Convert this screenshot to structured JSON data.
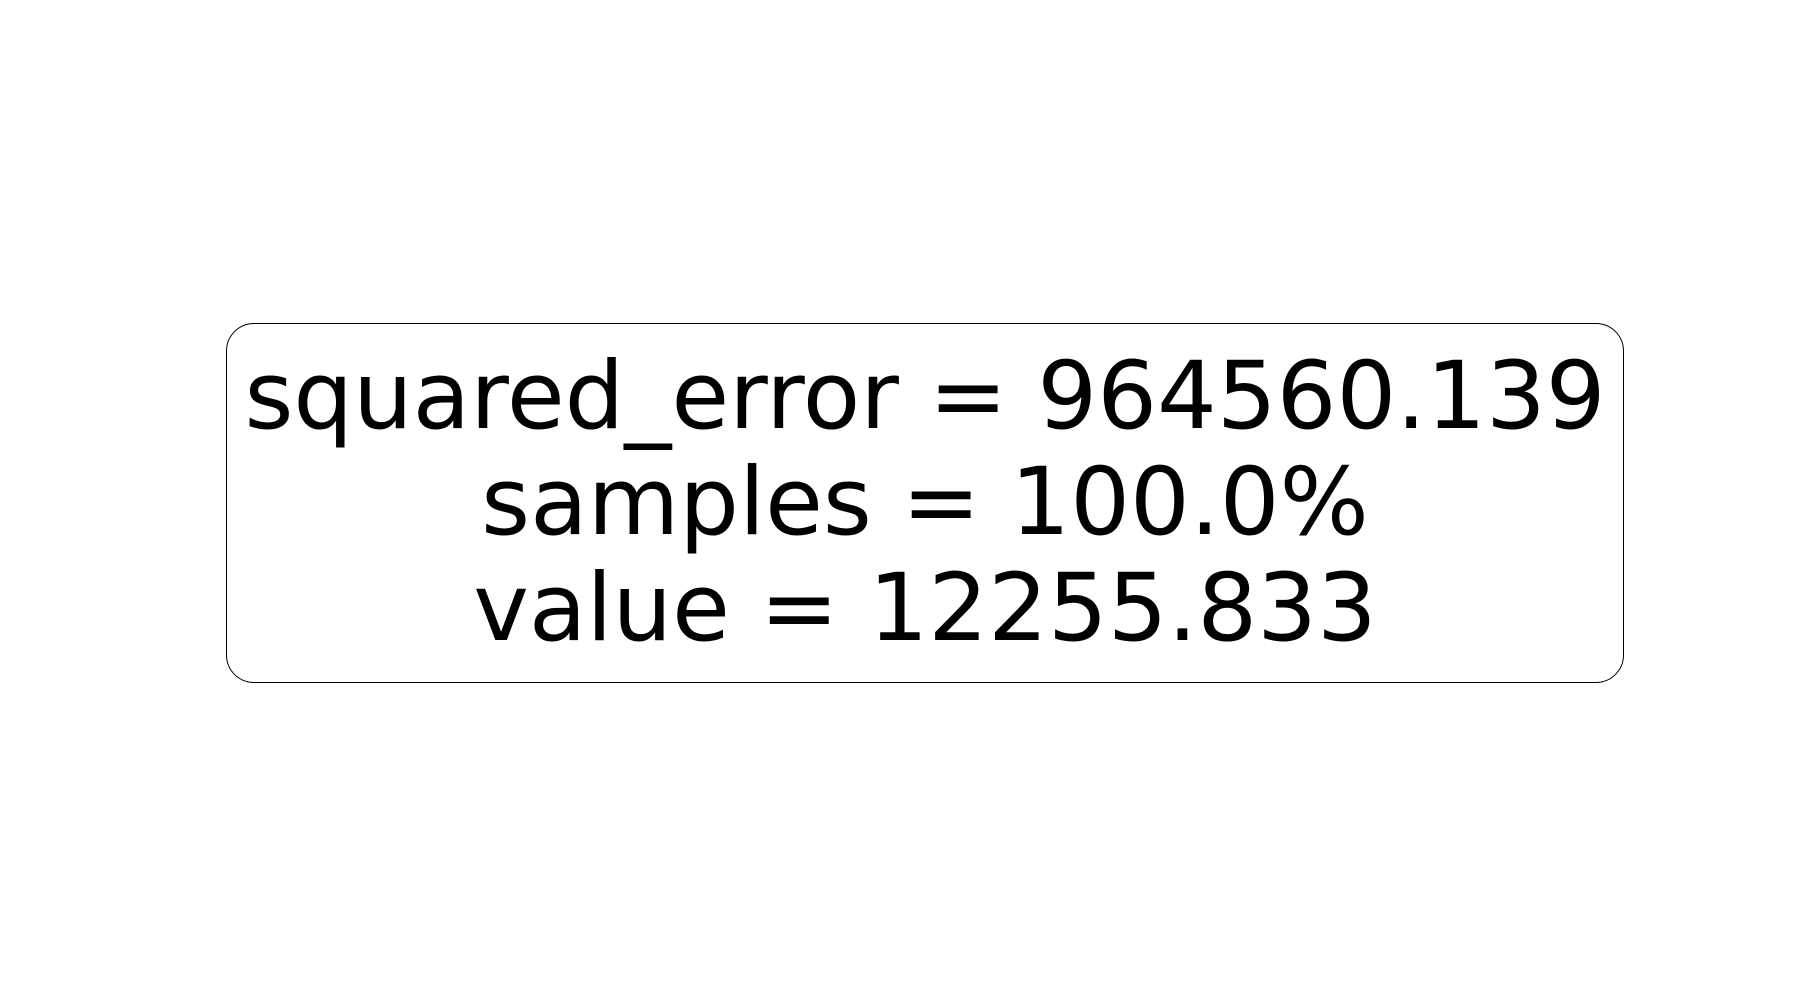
{
  "tree": {
    "root_node": {
      "lines": [
        "squared_error = 964560.139",
        "samples = 100.0%",
        "value = 12255.833"
      ],
      "squared_error": 964560.139,
      "samples_percent": 100.0,
      "value": 12255.833
    }
  }
}
